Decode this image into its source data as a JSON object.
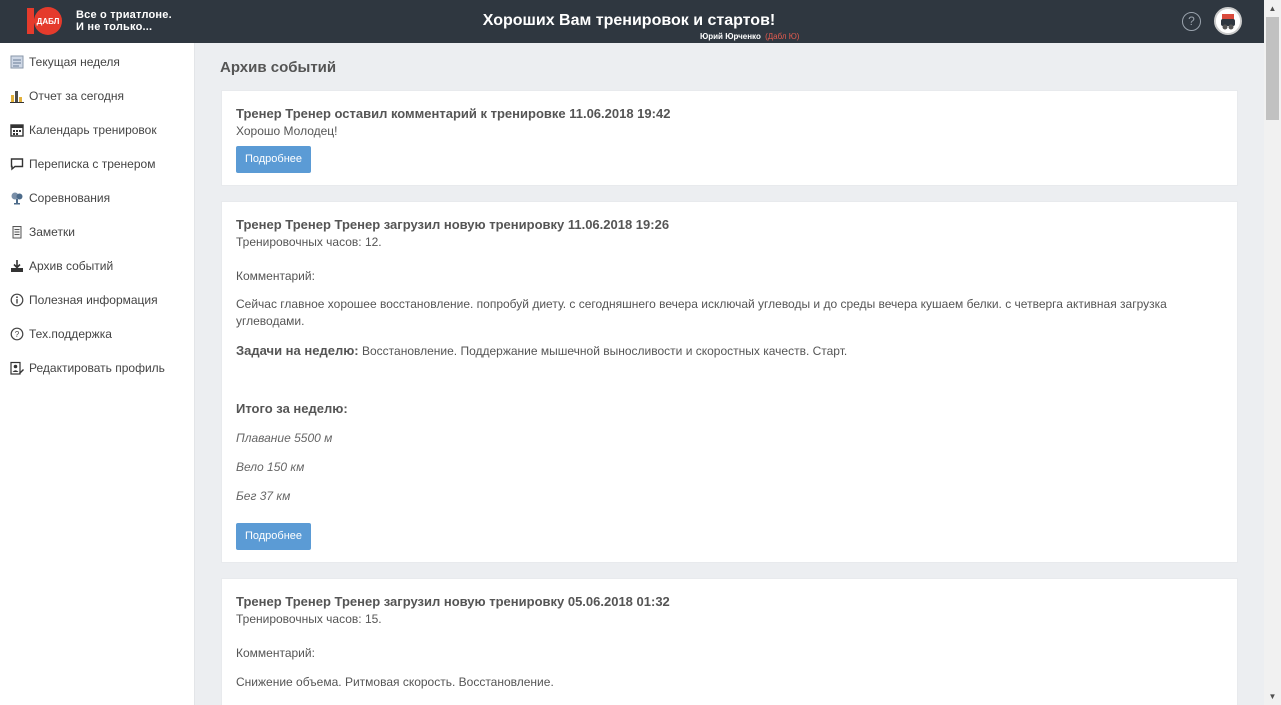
{
  "header": {
    "logo_line1": "Все о триатлоне.",
    "logo_line2": "И не только...",
    "title": "Хороших Вам тренировок и стартов!",
    "user_name": "Юрий Юрченко",
    "user_club": "(Дабл Ю)",
    "help_icon": "?",
    "brand_color": "#e53b2c"
  },
  "sidebar": {
    "items": [
      {
        "label": "Текущая неделя",
        "icon": "calendar-week-icon"
      },
      {
        "label": "Отчет за сегодня",
        "icon": "bar-chart-icon"
      },
      {
        "label": "Календарь тренировок",
        "icon": "calendar-icon"
      },
      {
        "label": "Переписка с тренером",
        "icon": "chat-icon"
      },
      {
        "label": "Соревнования",
        "icon": "trophy-icon"
      },
      {
        "label": "Заметки",
        "icon": "notes-icon"
      },
      {
        "label": "Архив событий",
        "icon": "download-icon"
      },
      {
        "label": "Полезная информация",
        "icon": "info-icon"
      },
      {
        "label": "Тех.поддержка",
        "icon": "help-icon"
      },
      {
        "label": "Редактировать профиль",
        "icon": "edit-profile-icon"
      }
    ]
  },
  "main": {
    "page_title": "Архив событий",
    "events": [
      {
        "title": "Тренер Тренер оставил комментарий к тренировке 11.06.2018 19:42",
        "body": "Хорошо Молодец!",
        "button": "Подробнее"
      },
      {
        "title": "Тренер Тренер Тренер загрузил новую тренировку 11.06.2018 19:26",
        "hours": "Тренировочных часов: 12.",
        "comment_label": "Комментарий:",
        "comment": "Сейчас главное хорошее восстановление. попробуй диету. с сегодняшнего вечера исключай углеводы и до среды вечера кушаем белки. с четверга активная загрузка углеводами.",
        "tasks_label": "Задачи на неделю:",
        "tasks": "Восстановление. Поддержание мышечной выносливости и скоростных качеств. Старт.",
        "total_label": "Итого за неделю:",
        "swim": "Плавание  5500 м",
        "bike": "Вело 150 км",
        "run": "Бег 37  км",
        "button": "Подробнее"
      },
      {
        "title": "Тренер Тренер Тренер загрузил новую тренировку 05.06.2018 01:32",
        "hours": "Тренировочных часов: 15.",
        "comment_label": "Комментарий:",
        "comment": "Снижение объема. Ритмовая скорость. Восстановление."
      }
    ]
  },
  "colors": {
    "header_bg": "#2f3740",
    "button_bg": "#5b9bd5",
    "page_bg": "#eceef1"
  }
}
